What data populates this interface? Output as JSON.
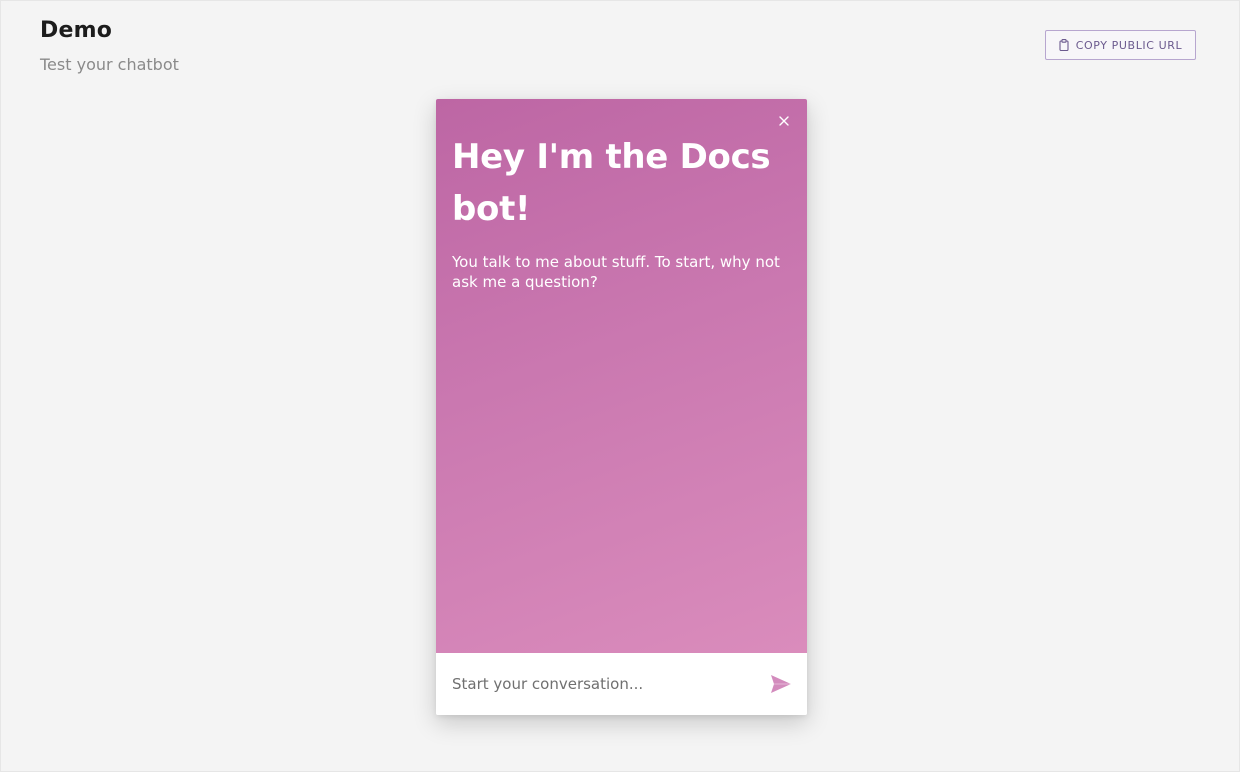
{
  "header": {
    "title": "Demo",
    "subtitle": "Test your chatbot"
  },
  "toolbar": {
    "copy_label": "COPY PUBLIC URL",
    "copy_icon": "clipboard-icon"
  },
  "chat": {
    "title": "Hey I'm the Docs bot!",
    "intro": "You talk to me about stuff. To start, why not ask me a question?",
    "input_placeholder": "Start your conversation...",
    "close_icon": "close-icon",
    "send_icon": "send-icon"
  },
  "colors": {
    "gradient_start": "#bd66a4",
    "gradient_end": "#da8cbc",
    "button_border": "#b7a6cf",
    "button_text": "#6b5a8e",
    "send_icon": "#d38bbd"
  }
}
